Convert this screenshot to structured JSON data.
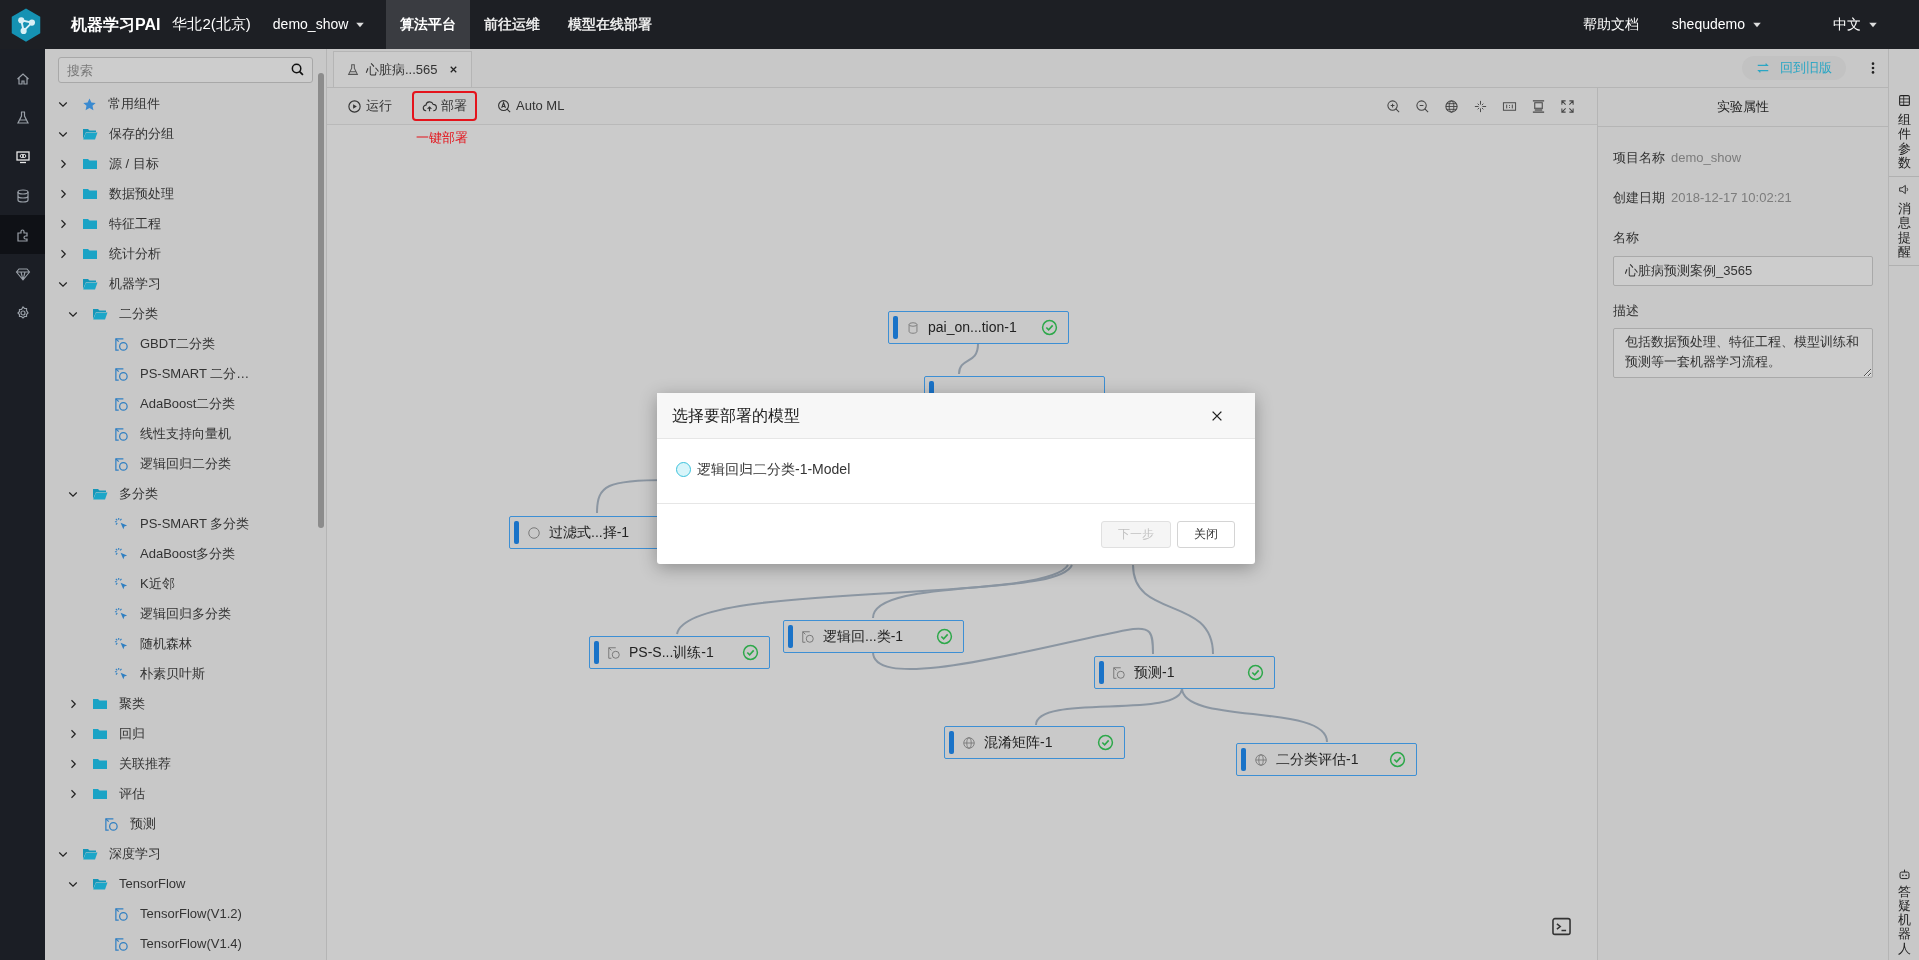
{
  "topbar": {
    "product": "机器学习PAI",
    "region": "华北2(北京)",
    "project": "demo_show",
    "nav": [
      {
        "label": "算法平台",
        "selected": true
      },
      {
        "label": "前往运维",
        "selected": false
      },
      {
        "label": "模型在线部署",
        "selected": false
      }
    ],
    "help": "帮助文档",
    "user": "shequdemo",
    "language": "中文"
  },
  "rail": [
    {
      "selected": false
    },
    {
      "selected": false
    },
    {
      "selected": false
    },
    {
      "selected": false
    },
    {
      "selected": true
    },
    {
      "selected": false
    },
    {
      "selected": false
    }
  ],
  "sidebar": {
    "search": {
      "placeholder": "搜索"
    },
    "items": [
      {
        "label": "常用组件",
        "kind": "star",
        "expanded": true
      },
      {
        "label": "保存的分组",
        "kind": "folder",
        "expanded": true
      },
      {
        "label": "源 / 目标",
        "kind": "folder",
        "expanded": false
      },
      {
        "label": "数据预处理",
        "kind": "folder",
        "expanded": false
      },
      {
        "label": "特征工程",
        "kind": "folder",
        "expanded": false
      },
      {
        "label": "统计分析",
        "kind": "folder",
        "expanded": false
      },
      {
        "label": "机器学习",
        "kind": "folder",
        "expanded": true,
        "children": [
          {
            "label": "二分类",
            "kind": "folder",
            "expanded": true,
            "children": [
              {
                "label": "GBDT二分类",
                "kind": "component"
              },
              {
                "label": "PS-SMART 二分…",
                "kind": "component"
              },
              {
                "label": "AdaBoost二分类",
                "kind": "component"
              },
              {
                "label": "线性支持向量机",
                "kind": "component"
              },
              {
                "label": "逻辑回归二分类",
                "kind": "component"
              }
            ]
          },
          {
            "label": "多分类",
            "kind": "folder",
            "expanded": true,
            "children": [
              {
                "label": "PS-SMART 多分类",
                "kind": "auto"
              },
              {
                "label": "AdaBoost多分类",
                "kind": "auto"
              },
              {
                "label": "K近邻",
                "kind": "auto"
              },
              {
                "label": "逻辑回归多分类",
                "kind": "auto"
              },
              {
                "label": "随机森林",
                "kind": "auto"
              },
              {
                "label": "朴素贝叶斯",
                "kind": "auto"
              }
            ]
          },
          {
            "label": "聚类",
            "kind": "folder",
            "expanded": false
          },
          {
            "label": "回归",
            "kind": "folder",
            "expanded": false
          },
          {
            "label": "关联推荐",
            "kind": "folder",
            "expanded": false
          },
          {
            "label": "评估",
            "kind": "folder",
            "expanded": false
          },
          {
            "label": "预测",
            "kind": "component"
          }
        ]
      },
      {
        "label": "深度学习",
        "kind": "folder",
        "expanded": true,
        "children": [
          {
            "label": "TensorFlow",
            "kind": "folder",
            "expanded": true,
            "children": [
              {
                "label": "TensorFlow(V1.2)",
                "kind": "component"
              },
              {
                "label": "TensorFlow(V1.4)",
                "kind": "component"
              }
            ]
          }
        ]
      }
    ]
  },
  "tab": {
    "label": "心脏病...565",
    "selected": true
  },
  "back_button": "回到旧版",
  "toolbar": {
    "buttons": [
      {
        "label": "运行",
        "highlighted": false
      },
      {
        "label": "部署",
        "highlighted": true
      },
      {
        "label": "Auto ML",
        "highlighted": false
      }
    ],
    "annotation": "一键部署"
  },
  "nodes": [
    {
      "label": "pai_on...tion-1",
      "kind": "database",
      "done": true
    },
    {
      "kind": "covered"
    },
    {
      "label": "过滤式...择-1",
      "kind": "circle"
    },
    {
      "label": "PS-S...训练-1",
      "kind": "component",
      "done": true
    },
    {
      "label": "逻辑回...类-1",
      "kind": "component",
      "done": true
    },
    {
      "label": "预测-1",
      "kind": "component",
      "done": true
    },
    {
      "label": "混淆矩阵-1",
      "kind": "globe",
      "done": true
    },
    {
      "label": "二分类评估-1",
      "kind": "globe",
      "done": true
    }
  ],
  "dialog": {
    "title": "选择要部署的模型",
    "options": [
      {
        "label": "逻辑回归二分类-1-Model",
        "selected": false
      }
    ],
    "buttons": [
      {
        "label": "下一步",
        "disabled": true
      },
      {
        "label": "关闭",
        "disabled": false
      }
    ]
  },
  "properties": {
    "title": "实验属性",
    "project_label": "项目名称",
    "project_value": "demo_show",
    "date_label": "创建日期",
    "date_value": "2018-12-17 10:02:21",
    "name_label": "名称",
    "name_value": "心脏病预测案例_3565",
    "desc_label": "描述",
    "desc_value": "包括数据预处理、特征工程、模型训练和预测等一套机器学习流程。"
  },
  "right_rail": [
    {
      "label": "组件参数"
    },
    {
      "label": "消息提醒"
    }
  ],
  "bot": {
    "label": "答疑机器人"
  }
}
